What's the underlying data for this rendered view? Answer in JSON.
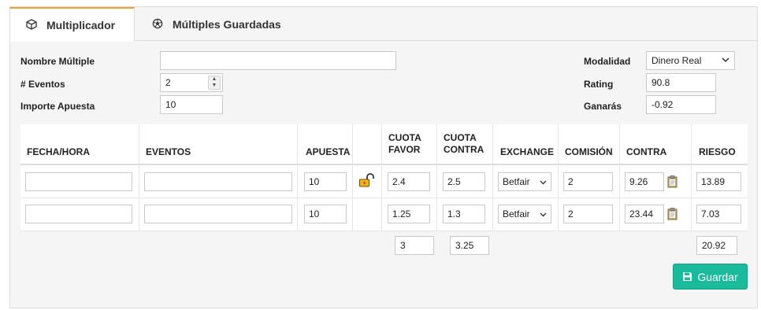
{
  "tabs": [
    {
      "label": "Multiplicador",
      "icon": "cube-icon",
      "active": true
    },
    {
      "label": "Múltiples Guardadas",
      "icon": "soccer-ball-icon",
      "active": false
    }
  ],
  "form": {
    "nombre_label": "Nombre Múltiple",
    "nombre_value": "",
    "eventos_label": "# Eventos",
    "eventos_value": "2",
    "importe_label": "Importe Apuesta",
    "importe_value": "10",
    "modalidad_label": "Modalidad",
    "modalidad_value": "Dinero Real",
    "rating_label": "Rating",
    "rating_value": "90.8",
    "ganaras_label": "Ganarás",
    "ganaras_value": "-0.92"
  },
  "table": {
    "headers": {
      "fecha": "FECHA/HORA",
      "eventos": "EVENTOS",
      "apuesta": "APUESTA",
      "cuota_favor_1": "CUOTA",
      "cuota_favor_2": "FAVOR",
      "cuota_contra_1": "CUOTA",
      "cuota_contra_2": "CONTRA",
      "exchange": "EXCHANGE",
      "comision": "COMISIÓN",
      "contra": "CONTRA",
      "riesgo": "RIESGO"
    },
    "rows": [
      {
        "fecha": "",
        "evento": "",
        "apuesta": "10",
        "locked": true,
        "cuota_favor": "2.4",
        "cuota_contra": "2.5",
        "exchange": "Betfair",
        "comision": "2",
        "contra": "9.26",
        "riesgo": "13.89"
      },
      {
        "fecha": "",
        "evento": "",
        "apuesta": "10",
        "locked": false,
        "cuota_favor": "1.25",
        "cuota_contra": "1.3",
        "exchange": "Betfair",
        "comision": "2",
        "contra": "23.44",
        "riesgo": "7.03"
      }
    ],
    "totals": {
      "cuota_favor": "3",
      "cuota_contra": "3.25",
      "riesgo": "20.92"
    }
  },
  "save_button": {
    "label": "Guardar",
    "icon": "floppy-disk-icon"
  },
  "colors": {
    "tab_accent": "#f0a030",
    "save_button": "#1abb9c",
    "lock_icon": "#e8a317"
  }
}
